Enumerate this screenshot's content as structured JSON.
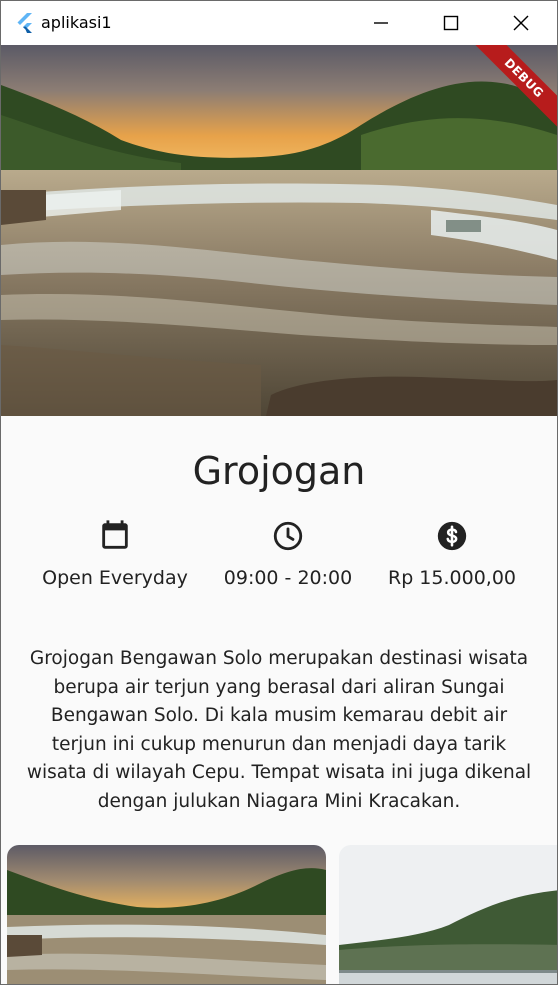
{
  "window": {
    "title": "aplikasi1",
    "logo_icon": "flutter-logo-icon",
    "controls": [
      "minimize-icon",
      "maximize-icon",
      "close-icon"
    ]
  },
  "debug_banner": "DEBUG",
  "place": {
    "name": "Grojogan",
    "info": [
      {
        "icon": "calendar-icon",
        "label": "Open Everyday"
      },
      {
        "icon": "clock-icon",
        "label": "09:00 - 20:00"
      },
      {
        "icon": "dollar-icon",
        "label": "Rp 15.000,00"
      }
    ],
    "description": "Grojogan Bengawan Solo merupakan destinasi wisata berupa air terjun yang berasal dari aliran Sungai Bengawan Solo. Di kala musim kemarau debit air terjun ini cukup menurun dan menjadi daya tarik wisata di wilayah Cepu. Tempat wisata ini juga dikenal dengan julukan Niagara Mini Kracakan."
  },
  "colors": {
    "debug": "#b71c1c",
    "flutter_blue": "#42a5f5",
    "text": "#222222"
  }
}
